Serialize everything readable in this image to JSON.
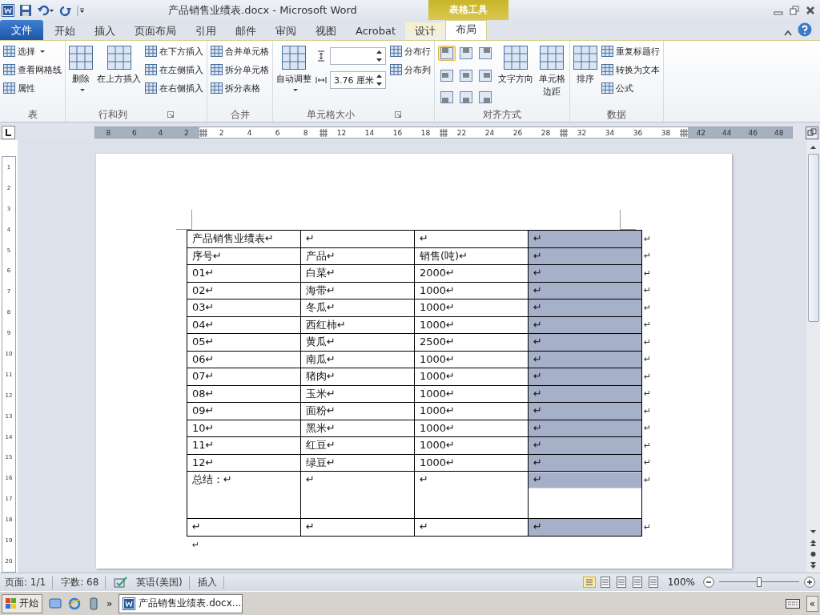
{
  "window": {
    "title": "产品销售业绩表.docx - Microsoft Word",
    "context_header": "表格工具"
  },
  "tabs": [
    {
      "label": "文件",
      "kind": "file",
      "selected": false
    },
    {
      "label": "开始",
      "kind": "normal",
      "selected": false
    },
    {
      "label": "插入",
      "kind": "normal",
      "selected": false
    },
    {
      "label": "页面布局",
      "kind": "normal",
      "selected": false
    },
    {
      "label": "引用",
      "kind": "normal",
      "selected": false
    },
    {
      "label": "邮件",
      "kind": "normal",
      "selected": false
    },
    {
      "label": "审阅",
      "kind": "normal",
      "selected": false
    },
    {
      "label": "视图",
      "kind": "normal",
      "selected": false
    },
    {
      "label": "Acrobat",
      "kind": "normal",
      "selected": false
    },
    {
      "label": "设计",
      "kind": "context",
      "selected": false
    },
    {
      "label": "布局",
      "kind": "context",
      "selected": true
    }
  ],
  "ribbon": {
    "groups": [
      {
        "label": "表",
        "launcher": false,
        "items": [
          {
            "kind": "stack",
            "buttons": [
              {
                "label": "选择",
                "caret": true
              },
              {
                "label": "查看网格线",
                "caret": false
              },
              {
                "label": "属性",
                "caret": false
              }
            ]
          }
        ]
      },
      {
        "label": "行和列",
        "launcher": true,
        "items": [
          {
            "kind": "large",
            "label": "删除",
            "caret": true
          },
          {
            "kind": "large",
            "label": "在上方插入",
            "caret": false
          },
          {
            "kind": "stack",
            "buttons": [
              {
                "label": "在下方插入",
                "caret": false
              },
              {
                "label": "在左侧插入",
                "caret": false
              },
              {
                "label": "在右侧插入",
                "caret": false
              }
            ]
          }
        ]
      },
      {
        "label": "合并",
        "launcher": false,
        "items": [
          {
            "kind": "stack",
            "buttons": [
              {
                "label": "合并单元格",
                "caret": false
              },
              {
                "label": "拆分单元格",
                "caret": false
              },
              {
                "label": "拆分表格",
                "caret": false
              }
            ]
          }
        ]
      },
      {
        "label": "单元格大小",
        "launcher": true,
        "items": [
          {
            "kind": "large",
            "label": "自动调整",
            "caret": true
          },
          {
            "kind": "fields",
            "fields": [
              {
                "kind": "height"
              },
              {
                "kind": "width",
                "value": "3.76 厘米"
              }
            ]
          },
          {
            "kind": "stack",
            "buttons": [
              {
                "label": "分布行",
                "caret": false
              },
              {
                "label": "分布列",
                "caret": false
              }
            ]
          }
        ]
      },
      {
        "label": "对齐方式",
        "launcher": false,
        "items": [
          {
            "kind": "align",
            "cells": [
              {
                "selected": true
              },
              {
                "selected": false
              },
              {
                "selected": false
              },
              {
                "selected": false
              },
              {
                "selected": false
              },
              {
                "selected": false
              },
              {
                "selected": false
              },
              {
                "selected": false
              },
              {
                "selected": false
              }
            ]
          },
          {
            "kind": "large",
            "label": "文字方向",
            "caret": false
          },
          {
            "kind": "large",
            "label": "单元格边距",
            "caret": false
          }
        ]
      },
      {
        "label": "数据",
        "launcher": false,
        "items": [
          {
            "kind": "large",
            "label": "排序",
            "caret": false
          },
          {
            "kind": "stack",
            "buttons": [
              {
                "label": "重复标题行",
                "caret": false
              },
              {
                "label": "转换为文本",
                "caret": false
              },
              {
                "label": "公式",
                "caret": false
              }
            ]
          }
        ]
      }
    ]
  },
  "ruler": {
    "segments": [
      {
        "kind": "margin",
        "labels": [
          "8",
          "6",
          "4",
          "2"
        ]
      },
      {
        "kind": "text",
        "labels": [
          "2",
          "4",
          "6",
          "8"
        ]
      },
      {
        "kind": "text",
        "labels": [
          "12",
          "14",
          "16",
          "18"
        ]
      },
      {
        "kind": "text",
        "labels": [
          "22",
          "24",
          "26",
          "28"
        ]
      },
      {
        "kind": "text",
        "labels": [
          "32",
          "34",
          "36",
          "38"
        ]
      },
      {
        "kind": "margin",
        "labels": [
          "42",
          "44",
          "46",
          "48"
        ]
      }
    ],
    "vertical_labels": [
      "1",
      "2",
      "3",
      "4",
      "5",
      "6",
      "7",
      "8",
      "9",
      "10",
      "11",
      "12",
      "13",
      "14",
      "15",
      "16",
      "17",
      "18",
      "19",
      "20"
    ]
  },
  "table": {
    "columns": [
      {
        "selected": false
      },
      {
        "selected": false
      },
      {
        "selected": false
      },
      {
        "selected": true
      }
    ],
    "rows": [
      {
        "kind": "normal",
        "end_mark": "↵",
        "cells": [
          "产品销售业绩表↵",
          "↵",
          "↵",
          "↵"
        ]
      },
      {
        "kind": "normal",
        "end_mark": "↵",
        "cells": [
          "序号↵",
          "产品↵",
          "销售(吨)↵",
          "↵"
        ]
      },
      {
        "kind": "normal",
        "end_mark": "↵",
        "cells": [
          "01↵",
          "白菜↵",
          "2000↵",
          "↵"
        ]
      },
      {
        "kind": "normal",
        "end_mark": "↵",
        "cells": [
          "02↵",
          "海带↵",
          "1000↵",
          "↵"
        ]
      },
      {
        "kind": "normal",
        "end_mark": "↵",
        "cells": [
          "03↵",
          "冬瓜↵",
          "1000↵",
          "↵"
        ]
      },
      {
        "kind": "normal",
        "end_mark": "↵",
        "cells": [
          "04↵",
          "西红柿↵",
          "1000↵",
          "↵"
        ]
      },
      {
        "kind": "normal",
        "end_mark": "↵",
        "cells": [
          "05↵",
          "黄瓜↵",
          "2500↵",
          "↵"
        ]
      },
      {
        "kind": "normal",
        "end_mark": "↵",
        "cells": [
          "06↵",
          "南瓜↵",
          "1000↵",
          "↵"
        ]
      },
      {
        "kind": "normal",
        "end_mark": "↵",
        "cells": [
          "07↵",
          "猪肉↵",
          "1000↵",
          "↵"
        ]
      },
      {
        "kind": "normal",
        "end_mark": "↵",
        "cells": [
          "08↵",
          "玉米↵",
          "1000↵",
          "↵"
        ]
      },
      {
        "kind": "normal",
        "end_mark": "↵",
        "cells": [
          "09↵",
          "面粉↵",
          "1000↵",
          "↵"
        ]
      },
      {
        "kind": "normal",
        "end_mark": "↵",
        "cells": [
          "10↵",
          "黑米↵",
          "1000↵",
          "↵"
        ]
      },
      {
        "kind": "normal",
        "end_mark": "↵",
        "cells": [
          "11↵",
          "红豆↵",
          "1000↵",
          "↵"
        ]
      },
      {
        "kind": "normal",
        "end_mark": "↵",
        "cells": [
          "12↵",
          "绿豆↵",
          "1000↵",
          "↵"
        ]
      },
      {
        "kind": "tall",
        "end_mark": "↵",
        "cells": [
          "总结：↵",
          "↵",
          "↵",
          "↵"
        ]
      },
      {
        "kind": "normal",
        "end_mark": "↵",
        "cells": [
          "↵",
          "↵",
          "↵",
          "↵"
        ]
      }
    ],
    "after_mark": "↵"
  },
  "status_bar": {
    "items": [
      "页面: 1/1",
      "字数: 68",
      "英语(美国)",
      "插入"
    ],
    "zoom": "100%",
    "zoom_slider": {
      "level": 0.5
    }
  },
  "taskbar": {
    "start": "开始",
    "more": "»",
    "task": "产品销售业绩表.docx...",
    "collapse": "«"
  }
}
